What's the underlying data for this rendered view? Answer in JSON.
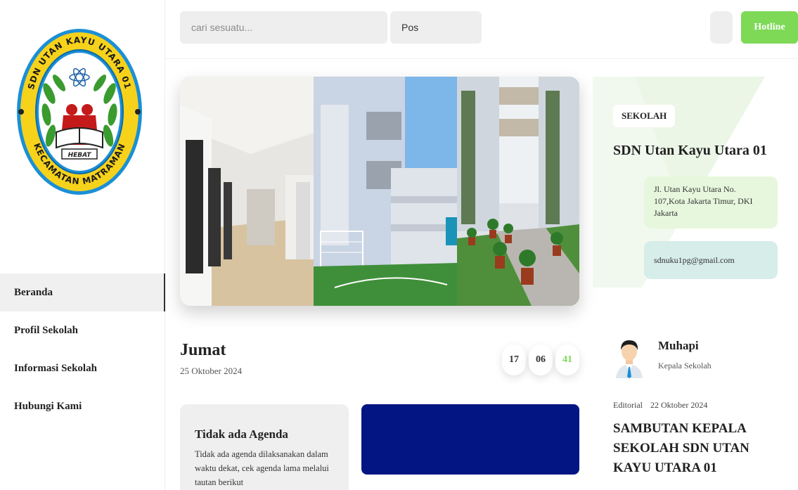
{
  "logo": {
    "top_text": "SDN UTAN KAYU UTARA 01",
    "bottom_text": "KECAMATAN MATRAMAN",
    "ribbon_text": "HEBAT"
  },
  "nav": {
    "items": [
      {
        "label": "Beranda",
        "active": true
      },
      {
        "label": "Profil Sekolah",
        "active": false
      },
      {
        "label": "Informasi Sekolah",
        "active": false
      },
      {
        "label": "Hubungi Kami",
        "active": false
      }
    ]
  },
  "topbar": {
    "search_placeholder": "cari sesuatu...",
    "select_value": "Pos",
    "search_icon": "",
    "icon_button": "",
    "hotline_label": "Hotline"
  },
  "school": {
    "badge": "SEKOLAH",
    "name": "SDN Utan Kayu Utara 01",
    "location_icon": "",
    "address": "Jl. Utan Kayu Utara No. 107,Kota Jakarta Timur, DKI Jakarta",
    "email_icon": "",
    "email": "sdnuku1pg@gmail.com"
  },
  "calendar": {
    "day": "Jumat",
    "date": "25 Oktober 2024",
    "hours": "17",
    "minutes": "06",
    "seconds": "41"
  },
  "principal": {
    "name": "Muhapi",
    "role": "Kepala Sekolah"
  },
  "agenda": {
    "title": "Tidak ada Agenda",
    "text": "Tidak ada agenda dilaksanakan dalam waktu dekat, cek agenda lama melalui tautan berikut"
  },
  "news": {
    "category": "Editorial",
    "date_icon": "",
    "date": "22 Oktober 2024",
    "title": "SAMBUTAN KEPALA SEKOLAH SDN UTAN KAYU UTARA 01"
  },
  "colors": {
    "accent_green": "#7ed957",
    "dark_blue": "#031582",
    "logo_yellow": "#f6d21b",
    "logo_blue": "#1b8fd6"
  }
}
